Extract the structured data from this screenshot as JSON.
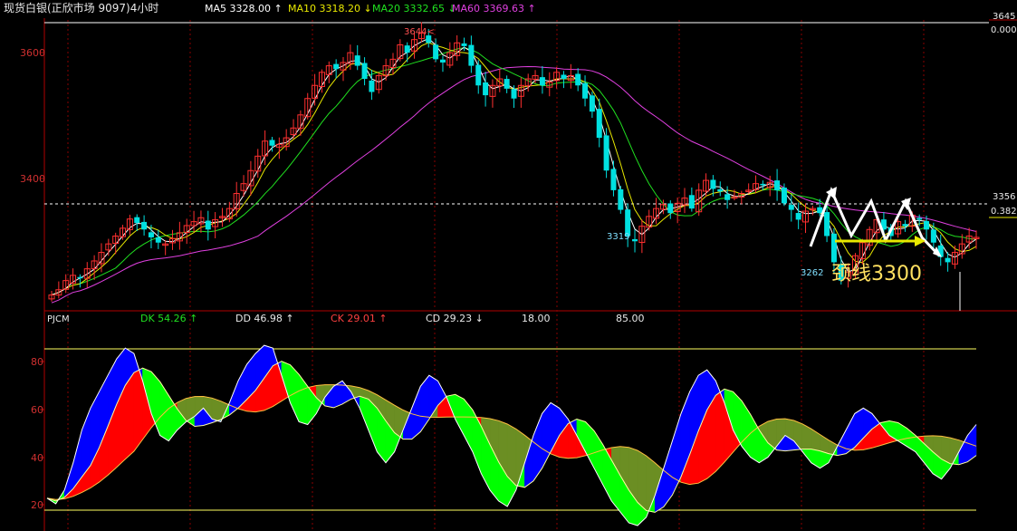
{
  "header": {
    "title": "现货白银(正欣市场 9097)4小时",
    "ma5": "MA5 3328.00 ↑",
    "ma10": "MA10 3318.20 ↓",
    "ma20": "MA20 3332.65 ↓",
    "ma60": "MA60 3369.63 ↑"
  },
  "colors": {
    "background": "#000000",
    "frame": "#b00000",
    "axis_text": "#d03030",
    "up_candle": "#ff3030",
    "down_candle": "#00e0e0",
    "ma5": "#ffffff",
    "ma10": "#e8e800",
    "ma20": "#20e020",
    "ma60": "#e040e0",
    "ind_red": "#ff0000",
    "ind_olive": "#6b8e23",
    "ind_blue": "#0000ff",
    "ind_green": "#00ff00",
    "ind_yellow_line": "#ffff60",
    "annotation": "#ffe060"
  },
  "price_panel": {
    "right_top": "3645",
    "right_top2": "0.000",
    "right_mid": "3356",
    "right_mid2": "0.382",
    "label_high": "3644<",
    "label_low1": "3319",
    "label_low2": "3262",
    "annotation_text": "颈线3300"
  },
  "indicator": {
    "name": "PJCM",
    "dk": "DK  54.26 ↑",
    "dd": "DD  46.98 ↑",
    "ck": "CK  29.01 ↑",
    "cd": "CD  29.23 ↓",
    "lvl1": "18.00",
    "lvl2": "85.00"
  },
  "chart_data": [
    {
      "type": "candlestick",
      "title": "现货白银(正欣市场 9097)4小时",
      "yticks": [
        "3600",
        "3400"
      ],
      "ylim": [
        3220,
        3660
      ],
      "price_labels": {
        "high": 3644,
        "low_a": 3319,
        "low_b": 3262
      },
      "right_axis": {
        "top": 3645,
        "top_ratio": 0.0,
        "fib": 3356,
        "fib_ratio": 0.382
      },
      "series": [
        {
          "name": "MA5",
          "value": 3328.0
        },
        {
          "name": "MA10",
          "value": 3318.2
        },
        {
          "name": "MA20",
          "value": 3332.65
        },
        {
          "name": "MA60",
          "value": 3369.63
        }
      ],
      "closes": [
        3240,
        3248,
        3262,
        3270,
        3266,
        3280,
        3292,
        3305,
        3318,
        3330,
        3342,
        3356,
        3350,
        3340,
        3328,
        3320,
        3318,
        3326,
        3335,
        3346,
        3352,
        3358,
        3340,
        3355,
        3360,
        3372,
        3395,
        3410,
        3430,
        3452,
        3475,
        3468,
        3470,
        3480,
        3495,
        3515,
        3540,
        3560,
        3580,
        3590,
        3585,
        3595,
        3610,
        3590,
        3570,
        3550,
        3575,
        3590,
        3600,
        3622,
        3610,
        3630,
        3640,
        3625,
        3600,
        3595,
        3610,
        3625,
        3620,
        3590,
        3560,
        3545,
        3560,
        3570,
        3555,
        3540,
        3560,
        3570,
        3575,
        3560,
        3565,
        3580,
        3570,
        3575,
        3560,
        3540,
        3520,
        3480,
        3430,
        3400,
        3370,
        3330,
        3322,
        3345,
        3360,
        3372,
        3378,
        3365,
        3380,
        3388,
        3372,
        3400,
        3415,
        3402,
        3398,
        3385,
        3390,
        3395,
        3400,
        3410,
        3408,
        3412,
        3400,
        3380,
        3370,
        3355,
        3368,
        3372,
        3365,
        3330,
        3290,
        3262,
        3275,
        3300,
        3320,
        3340,
        3355,
        3340,
        3330,
        3352,
        3345,
        3362,
        3355,
        3340,
        3320,
        3298,
        3290,
        3305,
        3318,
        3330,
        3328
      ],
      "annotations": [
        "颈线3300"
      ]
    },
    {
      "type": "line",
      "title": "PJCM",
      "yticks": [
        80,
        60,
        40,
        20
      ],
      "ylim": [
        15,
        90
      ],
      "levels": [
        18.0,
        85.0
      ],
      "series": [
        {
          "name": "DK",
          "value": 54.26,
          "values": [
            27,
            25,
            30,
            40,
            52,
            60,
            66,
            72,
            78,
            82,
            80,
            70,
            58,
            50,
            48,
            52,
            55,
            57,
            60,
            56,
            55,
            62,
            70,
            76,
            80,
            83,
            82,
            72,
            62,
            55,
            54,
            58,
            64,
            68,
            70,
            66,
            60,
            52,
            44,
            40,
            44,
            52,
            60,
            68,
            72,
            70,
            64,
            56,
            50,
            44,
            36,
            30,
            26,
            24,
            30,
            40,
            50,
            58,
            62,
            60,
            56,
            50,
            44,
            38,
            32,
            26,
            22,
            18,
            17,
            20,
            28,
            38,
            48,
            58,
            66,
            72,
            74,
            70,
            62,
            52,
            46,
            42,
            40,
            42,
            46,
            50,
            48,
            44,
            40,
            38,
            40,
            46,
            52,
            58,
            60,
            58,
            54,
            50,
            48,
            46,
            44,
            40,
            36,
            34,
            38,
            44,
            50,
            54
          ]
        },
        {
          "name": "DD",
          "value": 46.98
        },
        {
          "name": "CK",
          "value": 29.01
        },
        {
          "name": "CD",
          "value": 29.23
        }
      ]
    }
  ]
}
